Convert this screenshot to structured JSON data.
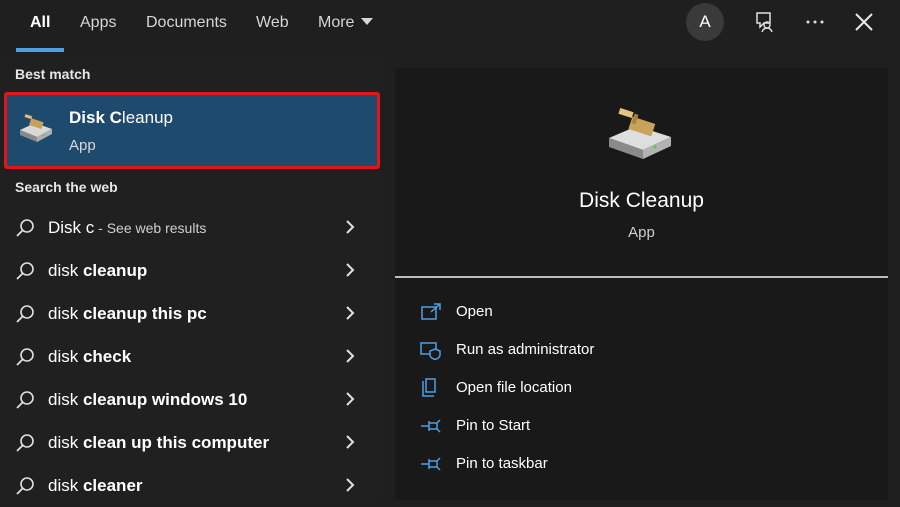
{
  "tabs": [
    {
      "label": "All",
      "active": true
    },
    {
      "label": "Apps"
    },
    {
      "label": "Documents"
    },
    {
      "label": "Web"
    },
    {
      "label": "More"
    }
  ],
  "header": {
    "avatar_letter": "A",
    "feedback_icon": "feedback-icon",
    "menu_icon": "ellipsis-icon",
    "close_icon": "close-icon"
  },
  "best_match": {
    "section_label": "Best match",
    "title_bold": "Disk C",
    "title_rest": "leanup",
    "subtitle": "App"
  },
  "web": {
    "section_label": "Search the web",
    "results": [
      {
        "query": "Disk c",
        "suffix": " - See web results"
      },
      {
        "prefix": "disk ",
        "bold": "cleanup"
      },
      {
        "prefix": "disk ",
        "bold": "cleanup this pc"
      },
      {
        "prefix": "disk ",
        "bold": "check"
      },
      {
        "prefix": "disk ",
        "bold": "cleanup windows 10"
      },
      {
        "prefix": "disk ",
        "bold": "clean up this computer"
      },
      {
        "prefix": "disk ",
        "bold": "cleaner"
      }
    ]
  },
  "detail": {
    "title": "Disk Cleanup",
    "subtitle": "App",
    "actions": [
      {
        "label": "Open",
        "icon": "open-icon"
      },
      {
        "label": "Run as administrator",
        "icon": "shield-icon"
      },
      {
        "label": "Open file location",
        "icon": "file-location-icon"
      },
      {
        "label": "Pin to Start",
        "icon": "pin-icon"
      },
      {
        "label": "Pin to taskbar",
        "icon": "pin-icon"
      }
    ]
  },
  "colors": {
    "accent": "#4ea0e6",
    "selection": "#1e4a6e",
    "highlight_border": "#e3151a",
    "background": "#1f1f1f"
  }
}
